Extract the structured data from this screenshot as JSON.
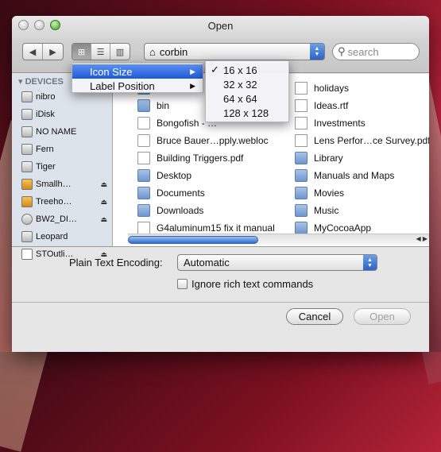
{
  "window": {
    "title": "Open"
  },
  "toolbar": {
    "back_icon": "◀",
    "forward_icon": "▶",
    "view_icons": [
      "⊞",
      "☰",
      "▥"
    ],
    "path": "corbin",
    "search_placeholder": "search"
  },
  "sidebar": {
    "heading": "DEVICES",
    "items": [
      {
        "label": "nibro",
        "eject": false
      },
      {
        "label": "iDisk",
        "eject": false
      },
      {
        "label": "NO NAME",
        "eject": false
      },
      {
        "label": "Fern",
        "eject": false
      },
      {
        "label": "Tiger",
        "eject": false
      },
      {
        "label": "Smallh…",
        "eject": true
      },
      {
        "label": "Treeho…",
        "eject": true
      },
      {
        "label": "BW2_DI…",
        "eject": true
      },
      {
        "label": "Leopard",
        "eject": false
      },
      {
        "label": "STOutli…",
        "eject": true
      }
    ]
  },
  "files": {
    "col1": [
      {
        "name": "",
        "type": "folder"
      },
      {
        "name": "bin",
        "type": "folder"
      },
      {
        "name": "Bongofish - …",
        "type": "web"
      },
      {
        "name": "Bruce Bauer…pply.webloc",
        "type": "web"
      },
      {
        "name": "Building Triggers.pdf",
        "type": "doc"
      },
      {
        "name": "Desktop",
        "type": "folder"
      },
      {
        "name": "Documents",
        "type": "folder"
      },
      {
        "name": "Downloads",
        "type": "folder"
      },
      {
        "name": "G4aluminum15 fix it manual",
        "type": "doc"
      }
    ],
    "col2": [
      {
        "name": "holidays",
        "type": "doc"
      },
      {
        "name": "Ideas.rtf",
        "type": "doc"
      },
      {
        "name": "Investments",
        "type": "doc"
      },
      {
        "name": "Lens Perfor…ce Survey.pdf",
        "type": "doc"
      },
      {
        "name": "Library",
        "type": "folder"
      },
      {
        "name": "Manuals and Maps",
        "type": "folder"
      },
      {
        "name": "Movies",
        "type": "folder"
      },
      {
        "name": "Music",
        "type": "folder"
      },
      {
        "name": "MyCocoaApp",
        "type": "folder"
      }
    ]
  },
  "options": {
    "encoding_label": "Plain Text Encoding:",
    "encoding_value": "Automatic",
    "ignore_rich_label": "Ignore rich text commands"
  },
  "buttons": {
    "cancel": "Cancel",
    "open": "Open"
  },
  "view_menu": {
    "items": [
      {
        "label": "Icon Size",
        "highlighted": true
      },
      {
        "label": "Label Position",
        "highlighted": false
      }
    ]
  },
  "icon_size_menu": {
    "items": [
      {
        "label": "16 x 16",
        "checked": true
      },
      {
        "label": "32 x 32",
        "checked": false
      },
      {
        "label": "64 x 64",
        "checked": false
      },
      {
        "label": "128 x 128",
        "checked": false
      }
    ]
  }
}
